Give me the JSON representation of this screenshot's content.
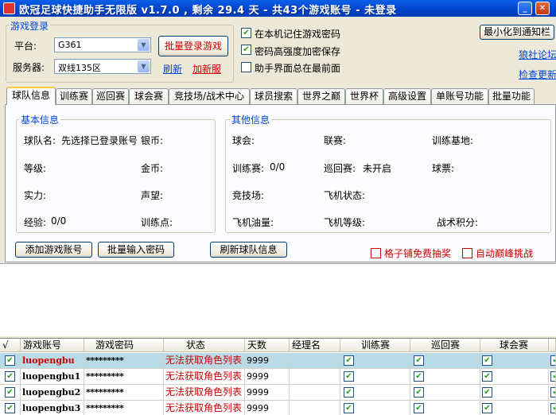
{
  "window": {
    "title": "欧冠足球快捷助手无限版 v1.7.0 , 剩余 29.4 天 - 共43个游戏账号 - 未登录",
    "minimize_glyph": "_",
    "close_glyph": "✕"
  },
  "login": {
    "group_label": "游戏登录",
    "platform_label": "平台:",
    "platform_value": "G361",
    "server_label": "服务器:",
    "server_value": "双线135区",
    "batch_login_button": "批量登录游戏",
    "refresh_link": "刷新",
    "new_server_link": "加新服"
  },
  "options": {
    "remember_password": {
      "label": "在本机记住游戏密码",
      "checked": true
    },
    "strong_encrypt": {
      "label": "密码高强度加密保存",
      "checked": true
    },
    "always_on_top": {
      "label": "助手界面总在最前面",
      "checked": false
    }
  },
  "top_right": {
    "minimize_tray_button": "最小化到通知栏",
    "forum_link": "狼社论坛",
    "check_update_link": "检查更新"
  },
  "tabs": [
    "球队信息",
    "训练赛",
    "巡回赛",
    "球会赛",
    "竞技场/战术中心",
    "球员搜索",
    "世界之巅",
    "世界杯",
    "高级设置",
    "单账号功能",
    "批量功能"
  ],
  "basic_info": {
    "label": "基本信息",
    "team_name_label": "球队名:",
    "team_name_value": "先选择已登录账号",
    "gold_coin_label": "银币:",
    "level_label": "等级:",
    "gold_label": "金币:",
    "strength_label": "实力:",
    "fame_label": "声望:",
    "exp_label": "经验:",
    "exp_value": "0/0",
    "training_points_label": "训练点:"
  },
  "other_info": {
    "label": "其他信息",
    "club_label": "球会:",
    "league_label": "联赛:",
    "training_base_label": "训练基地:",
    "training_match_label": "训练赛:",
    "training_match_value": "0/0",
    "tour_label": "巡回赛:",
    "tour_value": "未开启",
    "tickets_label": "球票:",
    "arena_label": "竞技场:",
    "plane_status_label": "飞机状态:",
    "plane_fuel_label": "飞机油量:",
    "plane_level_label": "飞机等级:",
    "tactic_points_label": "战术积分:"
  },
  "actions": {
    "add_account_button": "添加游戏账号",
    "batch_password_button": "批量输入密码",
    "refresh_team_button": "刷新球队信息",
    "free_lottery": {
      "label": "格子铺免费抽奖",
      "checked": false
    },
    "auto_peak": {
      "label": "自动巅峰挑战",
      "checked": false
    }
  },
  "table": {
    "headers": [
      "√",
      "游戏账号",
      "游戏密码",
      "状态",
      "天数",
      "经理名",
      "训练赛",
      "巡回赛",
      "球会赛"
    ],
    "rows": [
      {
        "checked": true,
        "account": "luopengbu",
        "password": "*********",
        "status": "无法获取角色列表",
        "days": "9999",
        "manager": "",
        "training": true,
        "tour": true,
        "club": true
      },
      {
        "checked": true,
        "account": "luopengbu1",
        "password": "*********",
        "status": "无法获取角色列表",
        "days": "9999",
        "manager": "",
        "training": true,
        "tour": true,
        "club": true
      },
      {
        "checked": true,
        "account": "luopengbu2",
        "password": "*********",
        "status": "无法获取角色列表",
        "days": "9999",
        "manager": "",
        "training": true,
        "tour": true,
        "club": true
      },
      {
        "checked": true,
        "account": "luopengbu3",
        "password": "*********",
        "status": "无法获取角色列表",
        "days": "9999",
        "manager": "",
        "training": true,
        "tour": true,
        "club": true
      }
    ]
  },
  "icons": {
    "check_glyph": "✔",
    "arrow_glyph": "▼"
  },
  "colors": {
    "title_bar": "#0a5fe8",
    "group_label": "#0046d5",
    "error_red": "#cc0000",
    "selected_row": "#b9dbe8"
  }
}
